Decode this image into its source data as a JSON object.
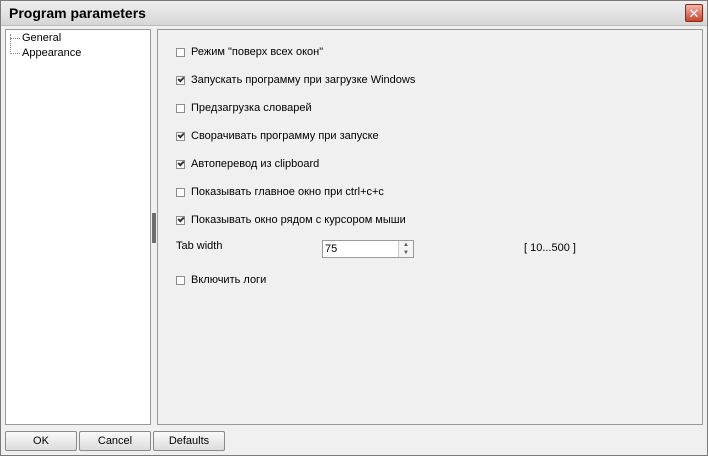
{
  "window": {
    "title": "Program parameters",
    "close_glyph": "✕"
  },
  "tree": {
    "items": [
      {
        "label": "General"
      },
      {
        "label": "Appearance"
      }
    ]
  },
  "options": [
    {
      "label": "Режим \"поверх всех окон\"",
      "checked": false
    },
    {
      "label": "Запускать программу при загрузке Windows",
      "checked": true
    },
    {
      "label": "Предзагрузка словарей",
      "checked": false
    },
    {
      "label": "Сворачивать программу при запуске",
      "checked": true
    },
    {
      "label": "Автоперевод из clipboard",
      "checked": true
    },
    {
      "label": "Показывать главное окно при ctrl+c+c",
      "checked": false
    },
    {
      "label": "Показывать окно рядом с курсором мыши",
      "checked": true
    }
  ],
  "tab_width": {
    "label": "Tab width",
    "value": "75",
    "range": "[ 10...500 ]"
  },
  "logs_option": {
    "label": "Включить логи",
    "checked": false
  },
  "buttons": {
    "ok": "OK",
    "cancel": "Cancel",
    "defaults": "Defaults"
  }
}
